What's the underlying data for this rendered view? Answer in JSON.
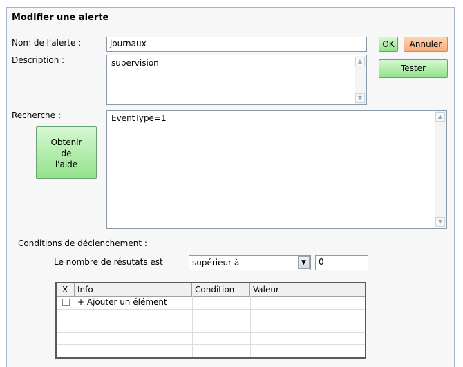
{
  "dialog": {
    "title": "Modifier une alerte"
  },
  "form": {
    "name_label": "Nom de l'alerte :",
    "name_value": "journaux",
    "description_label": "Description :",
    "description_value": "supervision",
    "search_label": "Recherche :",
    "search_value": "EventType=1",
    "help_button": "Obtenir\nde\nl'aide"
  },
  "buttons": {
    "ok": "OK",
    "cancel": "Annuler",
    "test": "Tester"
  },
  "conditions": {
    "label": "Conditions de déclenchement :",
    "count_label": "Le nombre de résutats est",
    "operator": "supérieur à",
    "threshold": "0"
  },
  "table": {
    "columns": [
      "X",
      "Info",
      "Condition",
      "Valeur"
    ],
    "rows": [
      {
        "checked": false,
        "info": "+ Ajouter un élément",
        "condition": "",
        "value": ""
      }
    ]
  }
}
